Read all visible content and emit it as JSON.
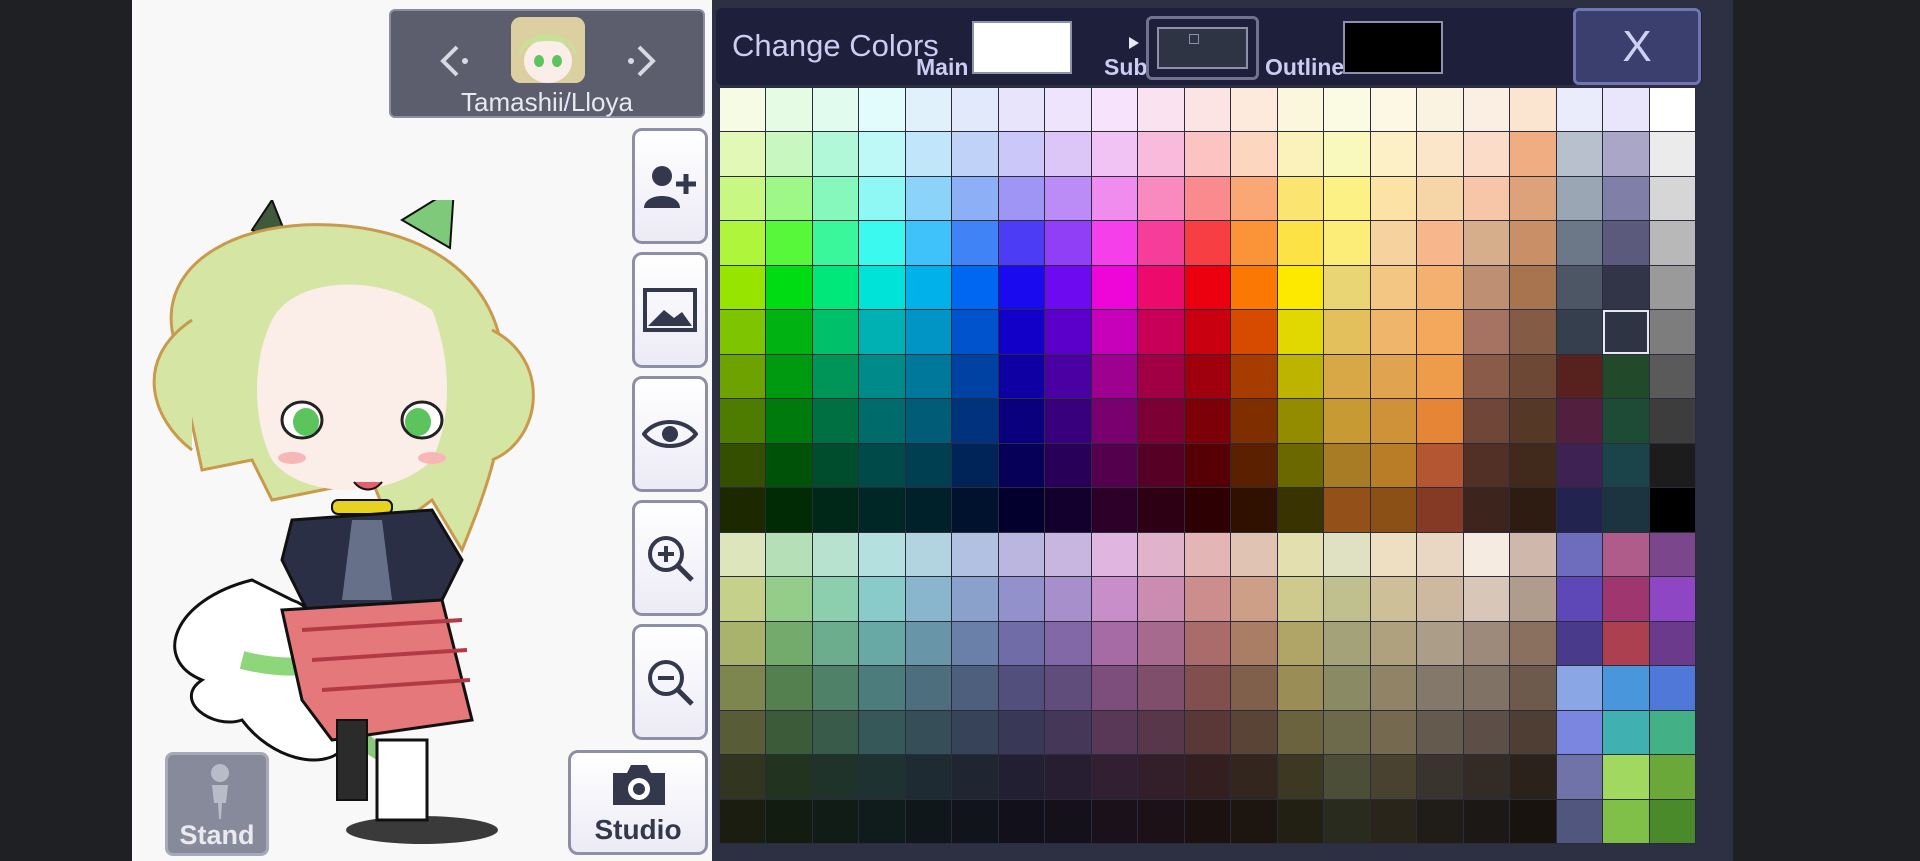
{
  "character": {
    "name": "Tamashii/Lloya",
    "prev_icon": "chevron-left-icon",
    "next_icon": "chevron-right-icon"
  },
  "side_buttons": [
    {
      "name": "add-character-button",
      "icon": "add-person-icon"
    },
    {
      "name": "background-button",
      "icon": "image-icon"
    },
    {
      "name": "visibility-button",
      "icon": "eye-icon"
    },
    {
      "name": "zoom-in-button",
      "icon": "zoom-in-icon"
    },
    {
      "name": "zoom-out-button",
      "icon": "zoom-out-icon"
    }
  ],
  "stand_button": {
    "label": "Stand",
    "icon": "figure-icon"
  },
  "studio_button": {
    "label": "Studio",
    "icon": "camera-icon"
  },
  "color_panel": {
    "title": "Change Colors",
    "main_label": "Main",
    "sub_label": "Sub",
    "outline_label": "Outline",
    "main_color": "#ffffff",
    "sub_color": "#2f3445",
    "outline_color": "#000000",
    "close_label": "X"
  },
  "palette": [
    [
      "#f6fbe6",
      "#e6fbe4",
      "#e2fbef",
      "#e2fbfb",
      "#e0f1fb",
      "#e1e9fb",
      "#e7e4fb",
      "#eee4fb",
      "#f7e3fb",
      "#fbe2f0",
      "#fde4e4",
      "#fdeadc",
      "#fbf7dc",
      "#fafbe2",
      "#fdf8e4",
      "#fbf3e2",
      "#fbeee2",
      "#fbe4d0",
      "#eaecfb",
      "#e9e6fb",
      "#ffffff"
    ],
    [
      "#e2f8b6",
      "#c8f8c0",
      "#b1f8d9",
      "#bff9f7",
      "#c1e6f9",
      "#c0d2f8",
      "#cbc7f8",
      "#dcc6f8",
      "#f1c2f4",
      "#f8bbdc",
      "#fbc4c3",
      "#fcd6bf",
      "#fbf1bb",
      "#f9f9be",
      "#fdf0c7",
      "#fbe6c9",
      "#fbdcc8",
      "#f0ad82",
      "#b8c0cd",
      "#aaa6c8",
      "#ebebeb"
    ],
    [
      "#c9f784",
      "#9ef887",
      "#87f8bc",
      "#8ff8f4",
      "#8bd3f8",
      "#8caff6",
      "#9f95f5",
      "#bc8cf6",
      "#ef8cee",
      "#f88abf",
      "#f98a8d",
      "#fba775",
      "#fbe46f",
      "#fbf185",
      "#fce2a4",
      "#f6d6a6",
      "#f7c6a8",
      "#dea27a",
      "#9aa6b3",
      "#7f7fa8",
      "#d6d6d6"
    ],
    [
      "#aef53b",
      "#57f73a",
      "#3bf79c",
      "#3cf9ef",
      "#3fc2f9",
      "#3f83f6",
      "#4c3cf5",
      "#913ff6",
      "#f53fea",
      "#f73d9a",
      "#f73e43",
      "#fb9438",
      "#fce244",
      "#fbed77",
      "#f6d29f",
      "#f8b68c",
      "#d7ae8b",
      "#c99068",
      "#6c7888",
      "#5c5a7c",
      "#b8b8b8"
    ],
    [
      "#97e400",
      "#00dc14",
      "#00e87a",
      "#00e3d9",
      "#00b2e9",
      "#0067f2",
      "#1a0af0",
      "#6e0af0",
      "#ee06d9",
      "#ec0a6c",
      "#ec0010",
      "#fb7804",
      "#fde900",
      "#ead574",
      "#f4c683",
      "#f3b06e",
      "#bf8f74",
      "#a8744f",
      "#4c5664",
      "#323448",
      "#9a9a9a"
    ],
    [
      "#7fc400",
      "#00b312",
      "#00c06a",
      "#00b1b4",
      "#0095c4",
      "#0053cd",
      "#1200c8",
      "#5b00cb",
      "#c700b9",
      "#c80057",
      "#c80010",
      "#d64b00",
      "#e0d800",
      "#e4c05c",
      "#efb56a",
      "#f3a85b",
      "#a67362",
      "#845b44",
      "#363f4e",
      "#2f3445",
      "#7d7d7d"
    ],
    [
      "#6ea200",
      "#009a10",
      "#009558",
      "#008b8b",
      "#00789b",
      "#0042a3",
      "#0e00a3",
      "#4a00a3",
      "#9e0090",
      "#a10045",
      "#a0000d",
      "#a63c00",
      "#bdb400",
      "#d8a846",
      "#e0a450",
      "#ee9b4a",
      "#8a5b48",
      "#6c4835",
      "#57211e",
      "#224a2a",
      "#5a5a5a"
    ],
    [
      "#4e7c00",
      "#007a0c",
      "#006f42",
      "#006b6b",
      "#005c77",
      "#00327d",
      "#0a007d",
      "#39007d",
      "#7a006f",
      "#7d0035",
      "#7d0009",
      "#7f2e00",
      "#938b00",
      "#c89a33",
      "#cf9238",
      "#e68536",
      "#6f4638",
      "#563826",
      "#521f3f",
      "#1e4b36",
      "#3d3d3d"
    ],
    [
      "#354f00",
      "#005209",
      "#004d2e",
      "#004a4a",
      "#003f52",
      "#002358",
      "#070058",
      "#280058",
      "#55004d",
      "#560025",
      "#560006",
      "#5a2000",
      "#6c6800",
      "#a87c24",
      "#b97d28",
      "#b55632",
      "#523026",
      "#41291b",
      "#3e2254",
      "#1a4449",
      "#1c1c1c"
    ],
    [
      "#1c2800",
      "#002b04",
      "#002818",
      "#002626",
      "#00202a",
      "#00122d",
      "#03002d",
      "#14002d",
      "#2c0028",
      "#2d0013",
      "#2d0003",
      "#301100",
      "#383300",
      "#935018",
      "#8a5015",
      "#853a25",
      "#3d241c",
      "#2e1c13",
      "#232350",
      "#1b3440",
      "#000000"
    ],
    [
      "#dce5bb",
      "#b5dfb7",
      "#b7e2cf",
      "#b4e0df",
      "#b2d4e0",
      "#b2c1e1",
      "#bbb6e0",
      "#c8b6e0",
      "#e0b5df",
      "#e0b3cb",
      "#e3b6b5",
      "#e1c3b3",
      "#e3dfaf",
      "#dfe1c2",
      "#eedec2",
      "#e9d7c4",
      "#f5ebe1",
      "#cfb8ab",
      "#6e6cbc",
      "#b05c8a",
      "#7c468c"
    ],
    [
      "#c5d18b",
      "#94cd8a",
      "#8ccfae",
      "#88cbc9",
      "#89b6cc",
      "#8aa1cc",
      "#9291cb",
      "#a68fca",
      "#c88ec9",
      "#cb8cb1",
      "#cc8e8c",
      "#cc9f86",
      "#cec98c",
      "#bfc08e",
      "#cdbf98",
      "#ccb9a0",
      "#d8c6b9",
      "#b09c8c",
      "#5e48b8",
      "#a03670",
      "#8e46c4"
    ],
    [
      "#a9b36c",
      "#73ab6c",
      "#6cad8d",
      "#68a9a6",
      "#6995a9",
      "#6a80a8",
      "#6f6ca7",
      "#8268a6",
      "#a66ba5",
      "#a66a8f",
      "#a96c6b",
      "#a97e64",
      "#b0a566",
      "#a3a278",
      "#b0a17e",
      "#ab9d87",
      "#9e8a7b",
      "#8a715f",
      "#4a3a8c",
      "#ac4050",
      "#6c3a8c"
    ],
    [
      "#7e8650",
      "#547f4f",
      "#4f8168",
      "#4c7d7c",
      "#4d6e7d",
      "#4e5f7e",
      "#534f7c",
      "#614d7c",
      "#7d4e7b",
      "#7e4e6a",
      "#814f4e",
      "#80604b",
      "#9a8d55",
      "#8a8a64",
      "#918466",
      "#84786b",
      "#807265",
      "#6e5a4c",
      "#8aa6e4",
      "#4a96dc",
      "#5078d8"
    ],
    [
      "#585d38",
      "#3c5b38",
      "#385b4a",
      "#365858",
      "#364e58",
      "#374358",
      "#3a3857",
      "#453757",
      "#583757",
      "#58374b",
      "#5b3838",
      "#5a4436",
      "#6b633d",
      "#6d6a4c",
      "#756a50",
      "#645a4e",
      "#5b4f47",
      "#4e3e34",
      "#7a86e0",
      "#40b0b0",
      "#44b086"
    ],
    [
      "#32351f",
      "#223320",
      "#1f332a",
      "#1e3232",
      "#1e2b32",
      "#1f2632",
      "#211f31",
      "#271f31",
      "#321f31",
      "#321f2a",
      "#331f1f",
      "#33261e",
      "#3d3822",
      "#4c4e38",
      "#4a4230",
      "#3a342e",
      "#322b26",
      "#2b221c",
      "#7073a8",
      "#a0d860",
      "#6aa83a"
    ],
    [
      "#1b1d10",
      "#121c11",
      "#111c17",
      "#101b1b",
      "#10171b",
      "#11151b",
      "#12111b",
      "#15111b",
      "#1b111b",
      "#1b1117",
      "#1c1111",
      "#1c1510",
      "#221f13",
      "#2a2b1f",
      "#29251a",
      "#201d19",
      "#1b1815",
      "#18130f",
      "#50567e",
      "#80c048",
      "#4a8a2a"
    ]
  ],
  "selected_swatch": {
    "row": 5,
    "col": 19
  }
}
